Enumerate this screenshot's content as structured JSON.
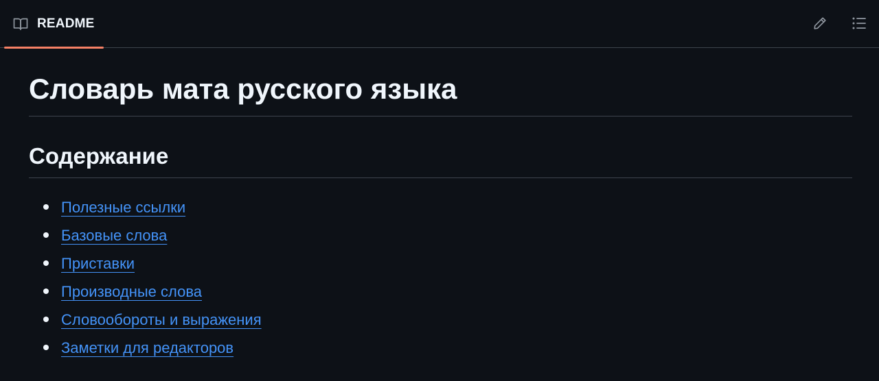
{
  "header": {
    "tab_label": "README",
    "tab_icon": "book-icon",
    "actions": [
      {
        "icon": "pencil-icon"
      },
      {
        "icon": "list-unordered-icon"
      }
    ]
  },
  "article": {
    "title": "Словарь мата русского языка",
    "toc_heading": "Содержание",
    "toc": [
      {
        "label": "Полезные ссылки"
      },
      {
        "label": "Базовые слова"
      },
      {
        "label": "Приставки"
      },
      {
        "label": "Производные слова"
      },
      {
        "label": "Словообороты и выражения"
      },
      {
        "label": "Заметки для редакторов"
      }
    ]
  },
  "colors": {
    "background": "#0d1117",
    "text": "#f0f6fc",
    "link": "#4493f8",
    "active_tab_underline": "#f78166",
    "border": "#3d444d",
    "icon": "#9198a1"
  }
}
